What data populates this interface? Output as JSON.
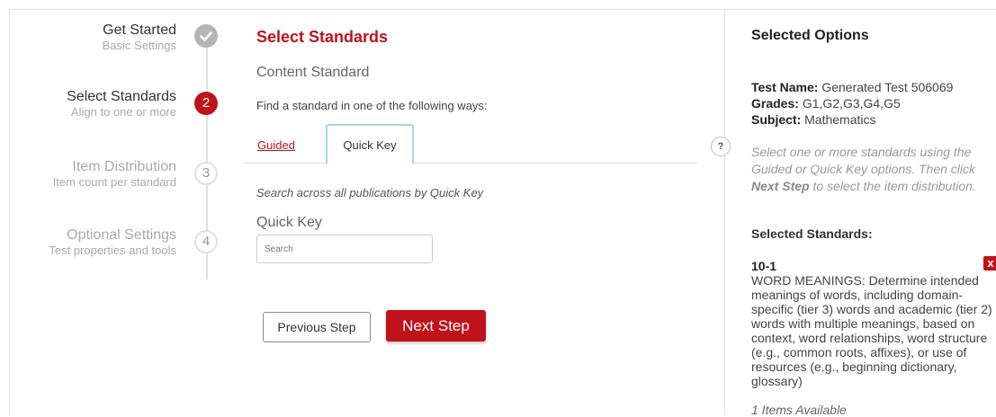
{
  "steps": [
    {
      "title": "Get Started",
      "subtitle": "Basic Settings",
      "status": "done",
      "number": "✓"
    },
    {
      "title": "Select Standards",
      "subtitle": "Align to one or more",
      "status": "active",
      "number": "2"
    },
    {
      "title": "Item Distribution",
      "subtitle": "Item count per standard",
      "status": "pending",
      "number": "3"
    },
    {
      "title": "Optional Settings",
      "subtitle": "Test properties and tools",
      "status": "pending",
      "number": "4"
    }
  ],
  "main": {
    "title": "Select Standards",
    "content_standard": "Content Standard",
    "find_text": "Find a standard in one of the following ways:",
    "tabs": [
      {
        "label": "Guided",
        "active": false
      },
      {
        "label": "Quick Key",
        "active": true
      }
    ],
    "search_across": "Search across all publications by Quick Key",
    "quick_key_label": "Quick Key",
    "search_placeholder": "Search",
    "search_value": "",
    "prev_label": "Previous Step",
    "next_label": "Next Step"
  },
  "panel": {
    "title": "Selected Options",
    "test_name_label": "Test Name:",
    "test_name": "Generated Test 506069",
    "grades_label": "Grades:",
    "grades": "G1,G2,G3,G4,G5",
    "subject_label": "Subject:",
    "subject": "Mathematics",
    "instr_1": "Select one or more standards using the",
    "instr_2": "Guided or Quick Key options. Then click",
    "instr_3_bold": "Next Step",
    "instr_3_rest": " to select the item distribution.",
    "selected_standards_label": "Selected Standards:",
    "standard": {
      "code": "10-1",
      "description": "WORD MEANINGS: Determine intended meanings of words, including domain-specific (tier 3) words and academic (tier 2) words with multiple meanings, based on context, word relationships, word structure (e.g., common roots, affixes), or use of resources (e.g., beginning dictionary, glossary)",
      "items_available": "1 Items Available"
    },
    "help_icon": "?",
    "remove_icon": "x"
  },
  "colors": {
    "accent": "#c0121b",
    "tab_border": "#a7d3e8"
  }
}
